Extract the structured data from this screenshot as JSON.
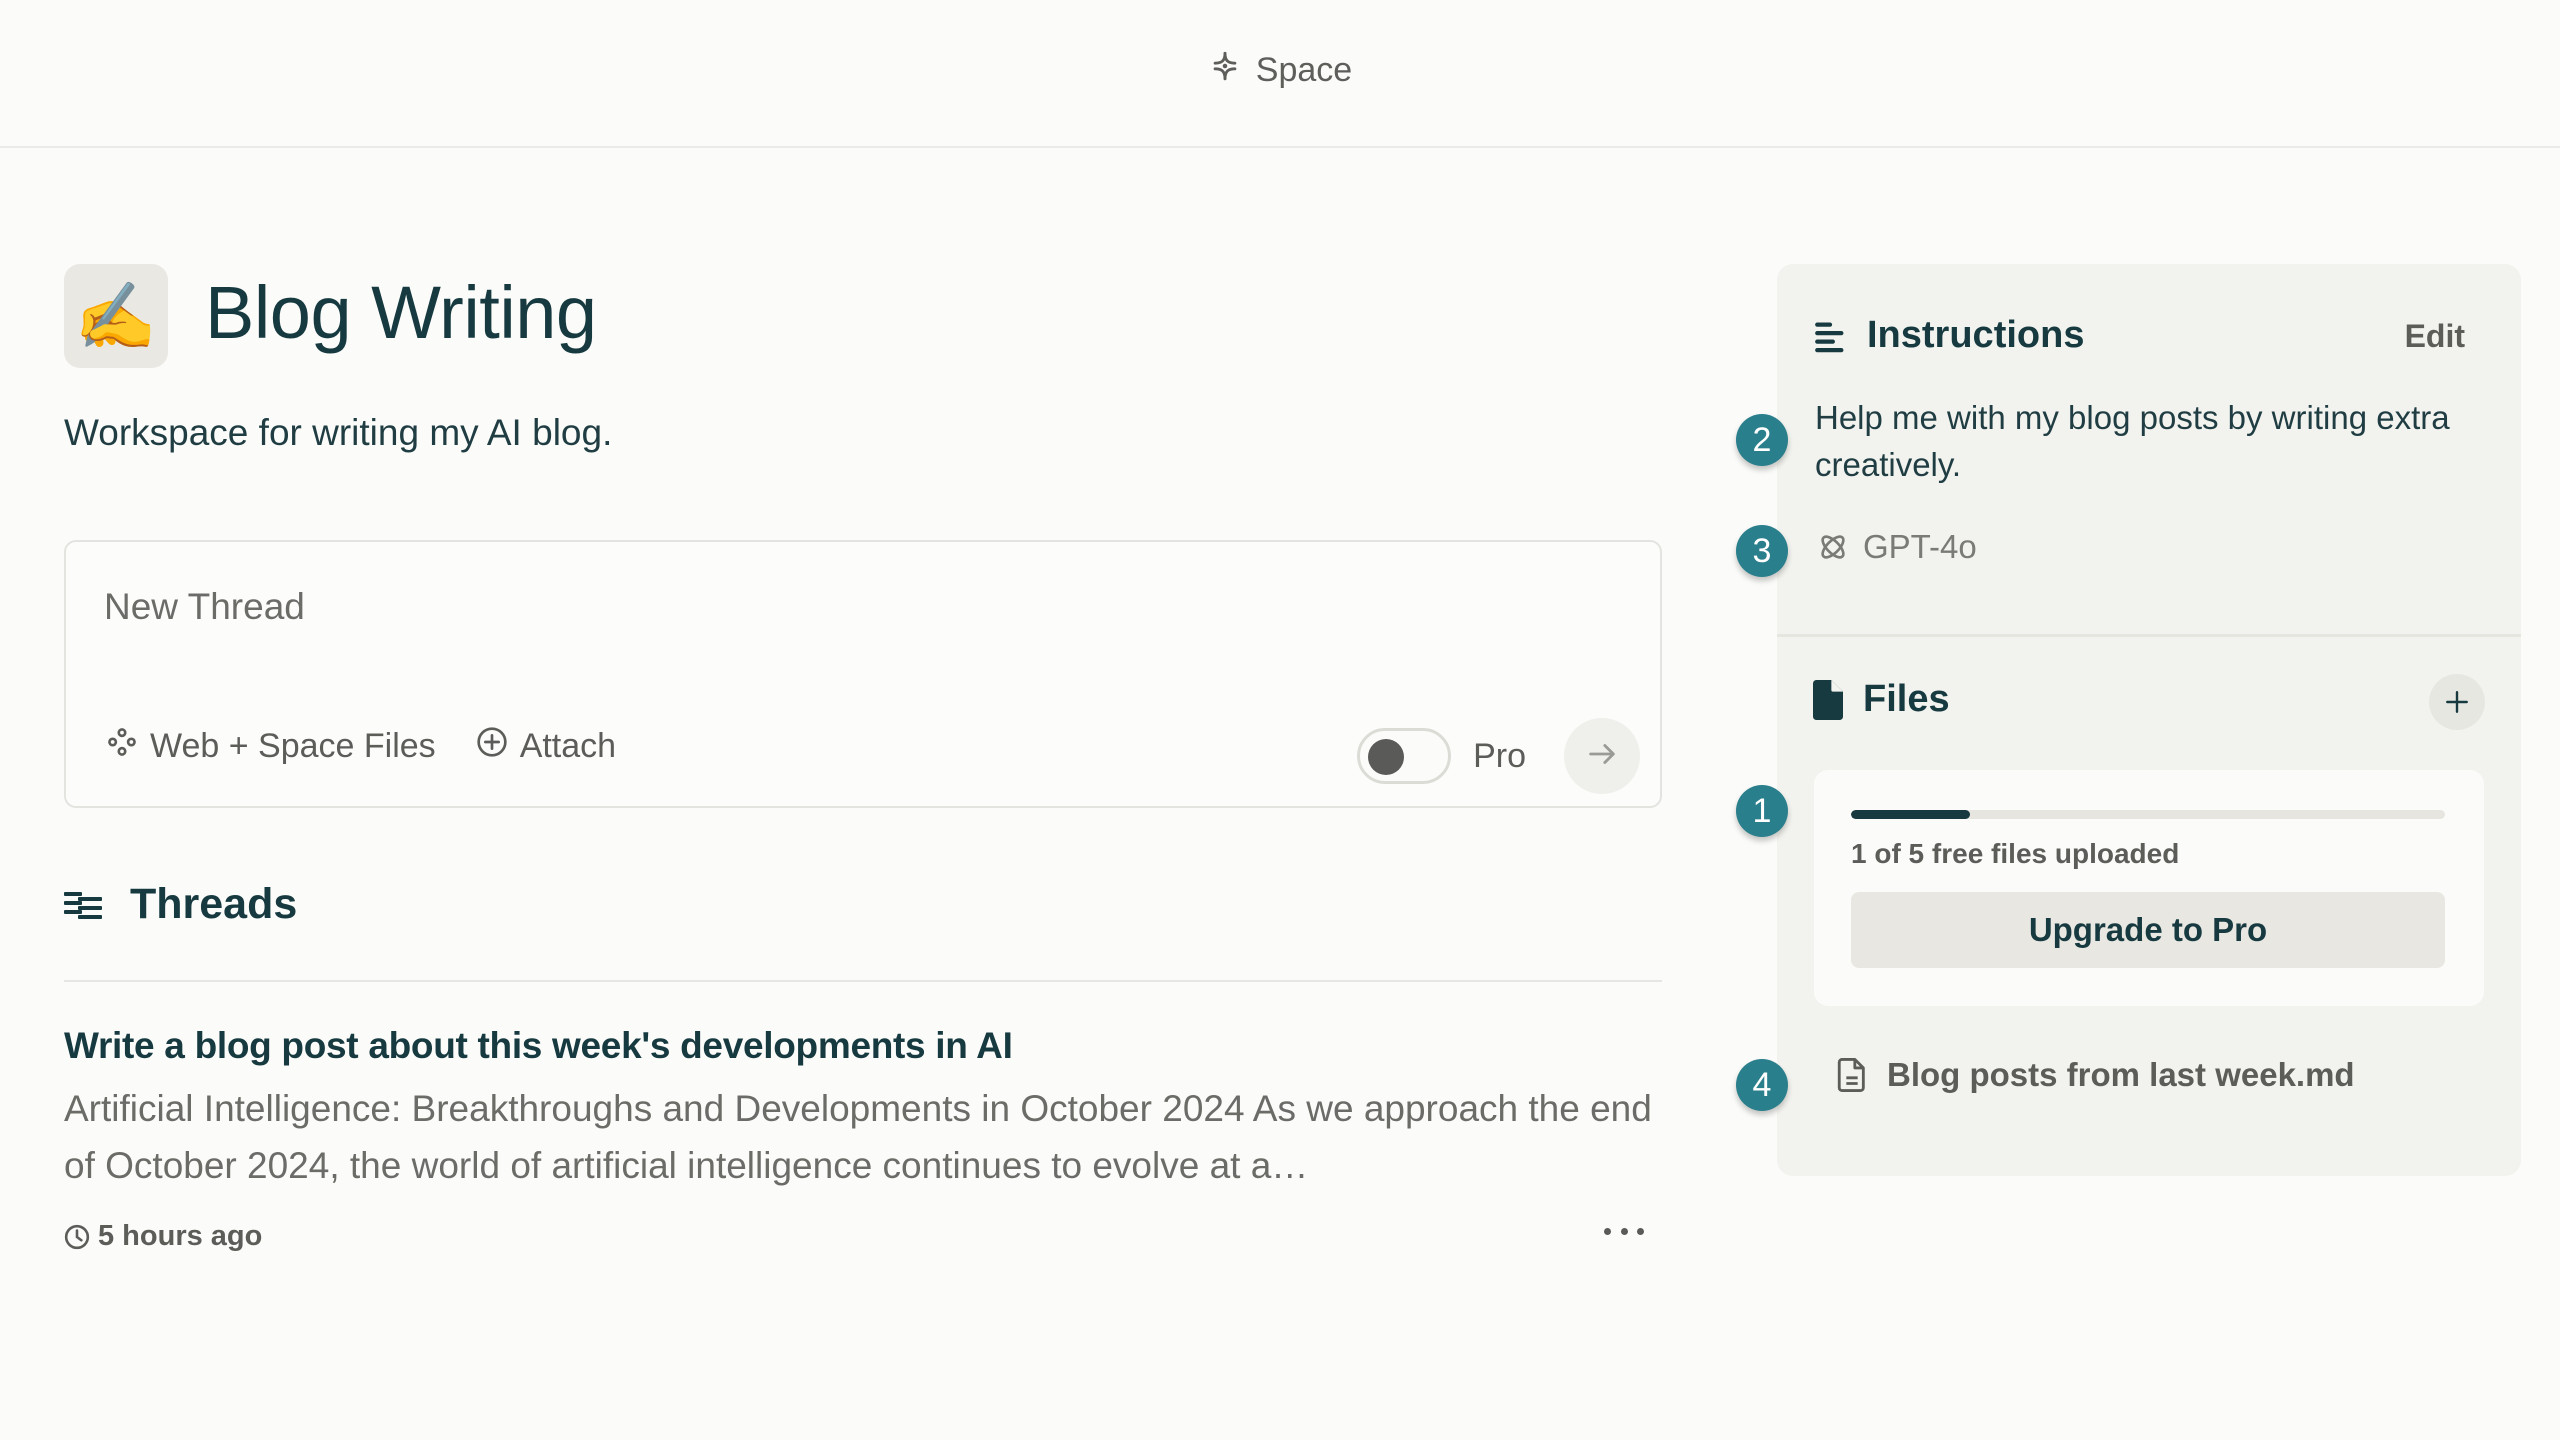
{
  "header": {
    "icon": "sparkle-icon",
    "title": "Space"
  },
  "space": {
    "emoji": "✍️",
    "title": "Blog Writing",
    "description": "Workspace for writing my AI blog."
  },
  "composer": {
    "placeholder": "New Thread",
    "source_label": "Web + Space Files",
    "attach_label": "Attach",
    "pro_label": "Pro",
    "pro_enabled": false
  },
  "threads": {
    "heading": "Threads",
    "items": [
      {
        "title": "Write a blog post about this week's developments in AI",
        "snippet": "Artificial Intelligence: Breakthroughs and Developments in October 2024 As we approach the end of October 2024, the world of artificial intelligence continues to evolve at a…",
        "time": "5 hours ago"
      }
    ]
  },
  "panel": {
    "instructions": {
      "heading": "Instructions",
      "edit_label": "Edit",
      "text": "Help me with my blog posts by writing extra creatively.",
      "model": "GPT-4o"
    },
    "files": {
      "heading": "Files",
      "quota_text": "1 of 5 free files uploaded",
      "quota_used": 1,
      "quota_total": 5,
      "upgrade_label": "Upgrade to Pro",
      "items": [
        {
          "name": "Blog posts from last week.md"
        }
      ]
    }
  },
  "annotations": [
    {
      "label": "1",
      "target": "files-quota"
    },
    {
      "label": "2",
      "target": "instructions-text"
    },
    {
      "label": "3",
      "target": "model-selector"
    },
    {
      "label": "4",
      "target": "file-item"
    }
  ],
  "colors": {
    "accent_dark": "#163a40",
    "badge": "#2a7f8c",
    "panel_bg": "#f2f2ee",
    "page_bg": "#fbfbf9"
  }
}
